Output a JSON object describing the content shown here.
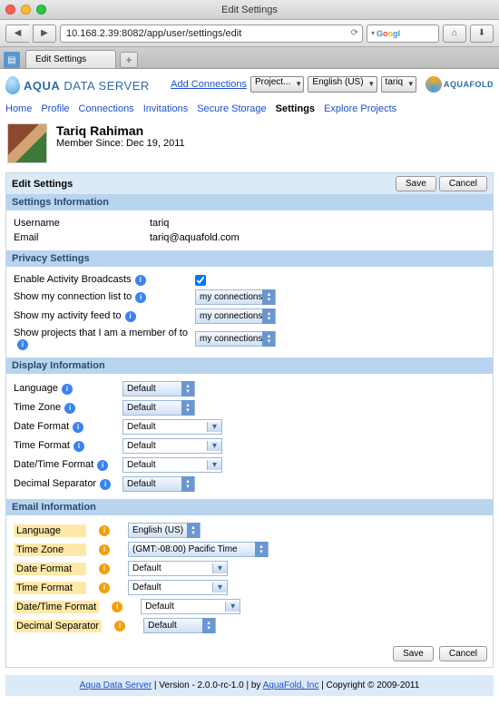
{
  "window": {
    "title": "Edit Settings"
  },
  "browser": {
    "url": "10.168.2.39:8082/app/user/settings/edit",
    "tab_label": "Edit Settings",
    "search_placeholder": ""
  },
  "brand": {
    "text1": "AQUA",
    "text2": " DATA SERVER",
    "logo_text": "AQUAFOLD"
  },
  "header_controls": {
    "add_connections": "Add Connections",
    "project_select": "Project...",
    "lang_select": "English (US)",
    "user_select": "tariq"
  },
  "nav": {
    "items": [
      "Home",
      "Profile",
      "Connections",
      "Invitations",
      "Secure Storage",
      "Settings",
      "Explore Projects"
    ],
    "active_index": 5
  },
  "profile": {
    "name": "Tariq Rahiman",
    "member_since": "Member Since: Dec 19, 2011"
  },
  "edit_title": "Edit Settings",
  "buttons": {
    "save": "Save",
    "cancel": "Cancel"
  },
  "sections": {
    "settings_info": {
      "title": "Settings Information",
      "username_label": "Username",
      "username_value": "tariq",
      "email_label": "Email",
      "email_value": "tariq@aquafold.com"
    },
    "privacy": {
      "title": "Privacy Settings",
      "rows": [
        {
          "label": "Enable Activity Broadcasts",
          "control": "checkbox",
          "checked": true
        },
        {
          "label": "Show my connection list to",
          "control": "select",
          "value": "my connections"
        },
        {
          "label": "Show my activity feed to",
          "control": "select",
          "value": "my connections"
        },
        {
          "label": "Show projects that I am a member of to",
          "control": "select",
          "value": "my connections"
        }
      ]
    },
    "display": {
      "title": "Display Information",
      "rows": [
        {
          "label": "Language",
          "control": "aqua",
          "value": "Default"
        },
        {
          "label": "Time Zone",
          "control": "aqua",
          "value": "Default"
        },
        {
          "label": "Date Format",
          "control": "combo",
          "value": "Default"
        },
        {
          "label": "Time Format",
          "control": "combo",
          "value": "Default"
        },
        {
          "label": "Date/Time Format",
          "control": "combo",
          "value": "Default"
        },
        {
          "label": "Decimal Separator",
          "control": "aqua",
          "value": "Default"
        }
      ]
    },
    "email": {
      "title": "Email Information",
      "rows": [
        {
          "label": "Language",
          "control": "aqua",
          "value": "English (US)"
        },
        {
          "label": "Time Zone",
          "control": "aqua",
          "value": "(GMT:-08:00) Pacific Time"
        },
        {
          "label": "Date Format",
          "control": "combo",
          "value": "Default"
        },
        {
          "label": "Time Format",
          "control": "combo",
          "value": "Default"
        },
        {
          "label": "Date/Time Format",
          "control": "combo",
          "value": "Default"
        },
        {
          "label": "Decimal Separator",
          "control": "aqua",
          "value": "Default"
        }
      ]
    }
  },
  "footer": {
    "link1": "Aqua Data Server",
    "mid": " | Version - 2.0.0-rc-1.0 | by ",
    "link2": "AquaFold, Inc",
    "tail": " | Copyright © 2009-2011"
  }
}
